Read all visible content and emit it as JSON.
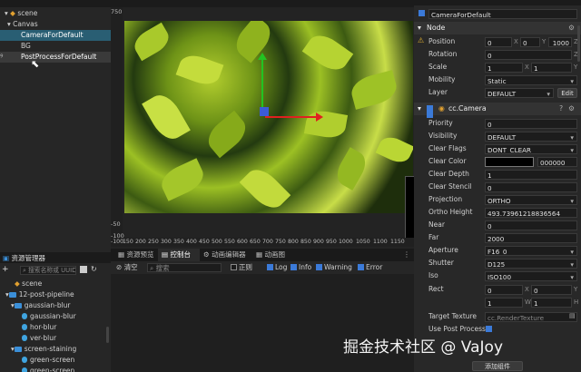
{
  "hierarchy": {
    "items": [
      {
        "label": "scene"
      },
      {
        "label": "Canvas"
      },
      {
        "label": "CameraForDefault"
      },
      {
        "label": "BG"
      },
      {
        "label": "PostProcessForDefault"
      }
    ]
  },
  "scene_view": {
    "ruler_left": [
      "750",
      "-50",
      "-100"
    ],
    "ruler_bottom": [
      "-100",
      "150",
      "200",
      "250",
      "300",
      "350",
      "400",
      "450",
      "500",
      "550",
      "600",
      "650",
      "700",
      "750",
      "800",
      "850",
      "900",
      "950",
      "1000",
      "1050",
      "1100",
      "1150"
    ]
  },
  "console": {
    "tabs": [
      "资源预览",
      "控制台",
      "动画编辑器",
      "动画图"
    ],
    "clear_label": "清空",
    "search_placeholder": "搜索",
    "regex_label": "正则",
    "filters": [
      "Log",
      "Info",
      "Warning",
      "Error"
    ]
  },
  "assets": {
    "title": "资源管理器",
    "search_placeholder": "搜索名称或 UUID",
    "items": [
      {
        "label": "scene",
        "type": "file",
        "indent": 2
      },
      {
        "label": "12-post-pipeline",
        "type": "folder",
        "indent": 1
      },
      {
        "label": "gaussian-blur",
        "type": "folder",
        "indent": 2
      },
      {
        "label": "gaussian-blur",
        "type": "file",
        "indent": 3
      },
      {
        "label": "hor-blur",
        "type": "file",
        "indent": 3
      },
      {
        "label": "ver-blur",
        "type": "file",
        "indent": 3
      },
      {
        "label": "screen-staining",
        "type": "folder",
        "indent": 2
      },
      {
        "label": "green-screen",
        "type": "file",
        "indent": 3
      },
      {
        "label": "green-screen",
        "type": "file",
        "indent": 3
      }
    ]
  },
  "inspector": {
    "node_name": "CameraForDefault",
    "node_section": "Node",
    "position": {
      "label": "Position",
      "x": "0",
      "y": "0",
      "z": "1000",
      "ax": "X",
      "ay": "Y",
      "az": "Z"
    },
    "rotation": {
      "label": "Rotation",
      "z": "0",
      "az": "Z"
    },
    "scale": {
      "label": "Scale",
      "x": "1",
      "y": "1",
      "ax": "X",
      "ay": "Y"
    },
    "mobility": {
      "label": "Mobility",
      "value": "Static"
    },
    "layer": {
      "label": "Layer",
      "value": "DEFAULT",
      "edit": "Edit"
    },
    "camera_section": "cc.Camera",
    "priority": {
      "label": "Priority",
      "value": "0"
    },
    "visibility": {
      "label": "Visibility",
      "value": "DEFAULT"
    },
    "clear_flags": {
      "label": "Clear Flags",
      "value": "DONT_CLEAR"
    },
    "clear_color": {
      "label": "Clear Color",
      "value": "000000"
    },
    "clear_depth": {
      "label": "Clear Depth",
      "value": "1"
    },
    "clear_stencil": {
      "label": "Clear Stencil",
      "value": "0"
    },
    "projection": {
      "label": "Projection",
      "value": "ORTHO"
    },
    "ortho_height": {
      "label": "Ortho Height",
      "value": "493.73961218836564"
    },
    "near": {
      "label": "Near",
      "value": "0"
    },
    "far": {
      "label": "Far",
      "value": "2000"
    },
    "aperture": {
      "label": "Aperture",
      "value": "F16_0"
    },
    "shutter": {
      "label": "Shutter",
      "value": "D125"
    },
    "iso": {
      "label": "Iso",
      "value": "ISO100"
    },
    "rect": {
      "label": "Rect",
      "x": "0",
      "y": "0",
      "w": "1",
      "h": "1",
      "ax": "X",
      "ay": "Y",
      "aw": "W",
      "ah": "H"
    },
    "target_texture": {
      "label": "Target Texture",
      "value": "cc.RenderTexture"
    },
    "use_post_process": {
      "label": "Use Post Process"
    },
    "add_component": "添加组件"
  },
  "watermark": "掘金技术社区 @ VaJoy",
  "colors": {
    "selection": "#295e73",
    "accent": "#3b7ad8"
  }
}
